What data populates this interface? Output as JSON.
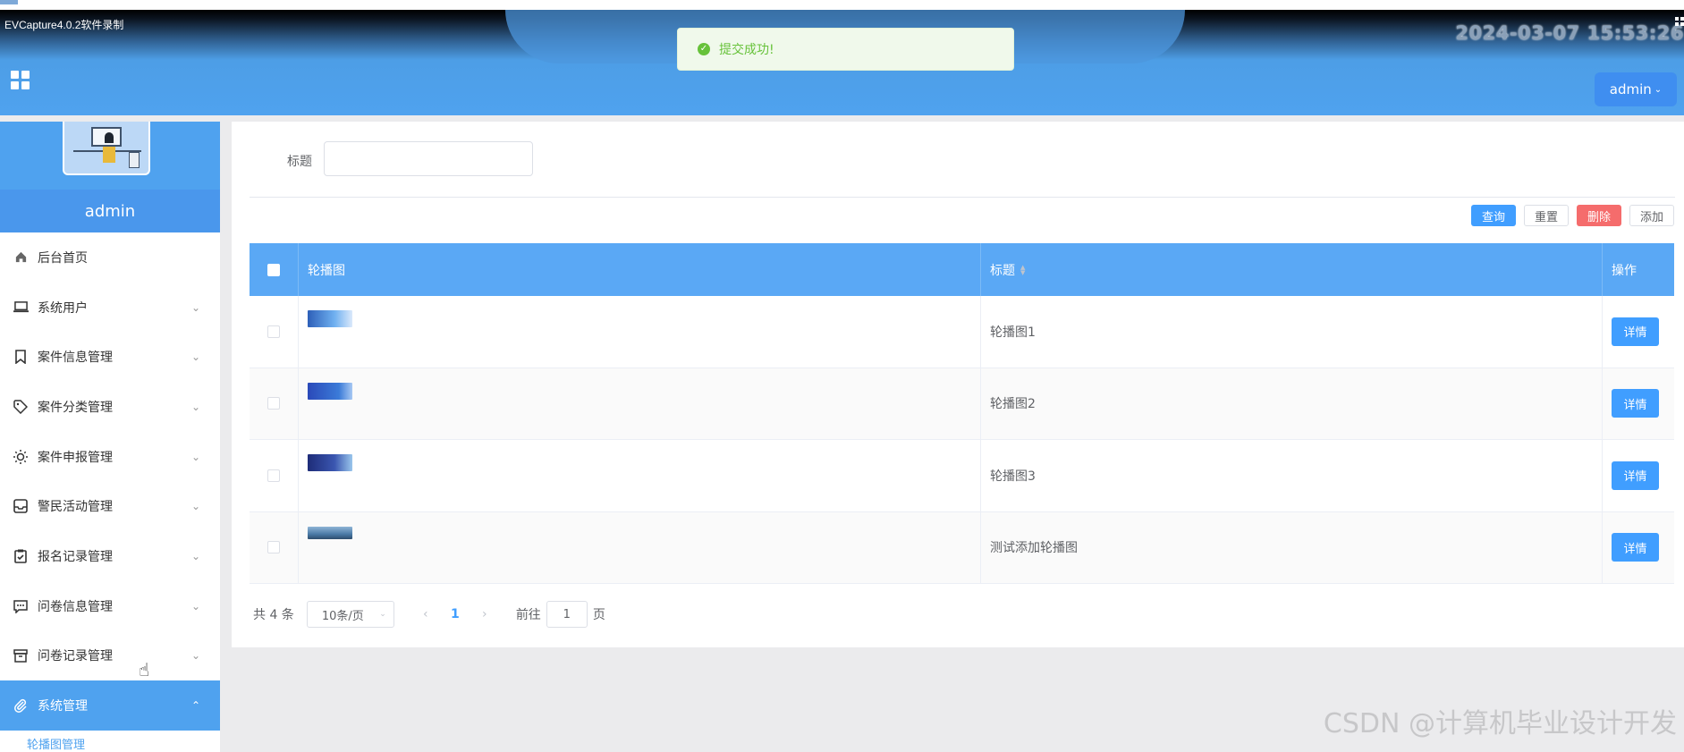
{
  "recording_bar": {
    "title": "EVCapture4.0.2软件录制",
    "timestamp": "2024-03-07 15:53:26"
  },
  "header": {
    "user_menu_label": "admin"
  },
  "toast": {
    "message": "提交成功!"
  },
  "sidebar": {
    "username": "admin",
    "items": [
      {
        "label": "后台首页",
        "icon": "home-icon"
      },
      {
        "label": "系统用户",
        "icon": "laptop-icon"
      },
      {
        "label": "案件信息管理",
        "icon": "bookmark-icon"
      },
      {
        "label": "案件分类管理",
        "icon": "tag-icon"
      },
      {
        "label": "案件申报管理",
        "icon": "sun-icon"
      },
      {
        "label": "警民活动管理",
        "icon": "inbox-icon"
      },
      {
        "label": "报名记录管理",
        "icon": "clipboard-check-icon"
      },
      {
        "label": "问卷信息管理",
        "icon": "message-icon"
      },
      {
        "label": "问卷记录管理",
        "icon": "archive-icon"
      },
      {
        "label": "系统管理",
        "icon": "paperclip-icon"
      }
    ],
    "sub_item": "轮播图管理"
  },
  "search": {
    "label": "标题",
    "value": ""
  },
  "toolbar": {
    "query": "查询",
    "reset": "重置",
    "delete": "删除",
    "add": "添加"
  },
  "table": {
    "columns": [
      "轮播图",
      "标题",
      "操作"
    ],
    "rows": [
      {
        "title": "轮播图1",
        "action": "详情"
      },
      {
        "title": "轮播图2",
        "action": "详情"
      },
      {
        "title": "轮播图3",
        "action": "详情"
      },
      {
        "title": "测试添加轮播图",
        "action": "详情"
      }
    ]
  },
  "pagination": {
    "total_text": "共 4 条",
    "page_size": "10条/页",
    "current_page": "1",
    "goto_label": "前往",
    "goto_value": "1",
    "goto_suffix": "页"
  },
  "watermark": "CSDN @计算机毕业设计开发"
}
